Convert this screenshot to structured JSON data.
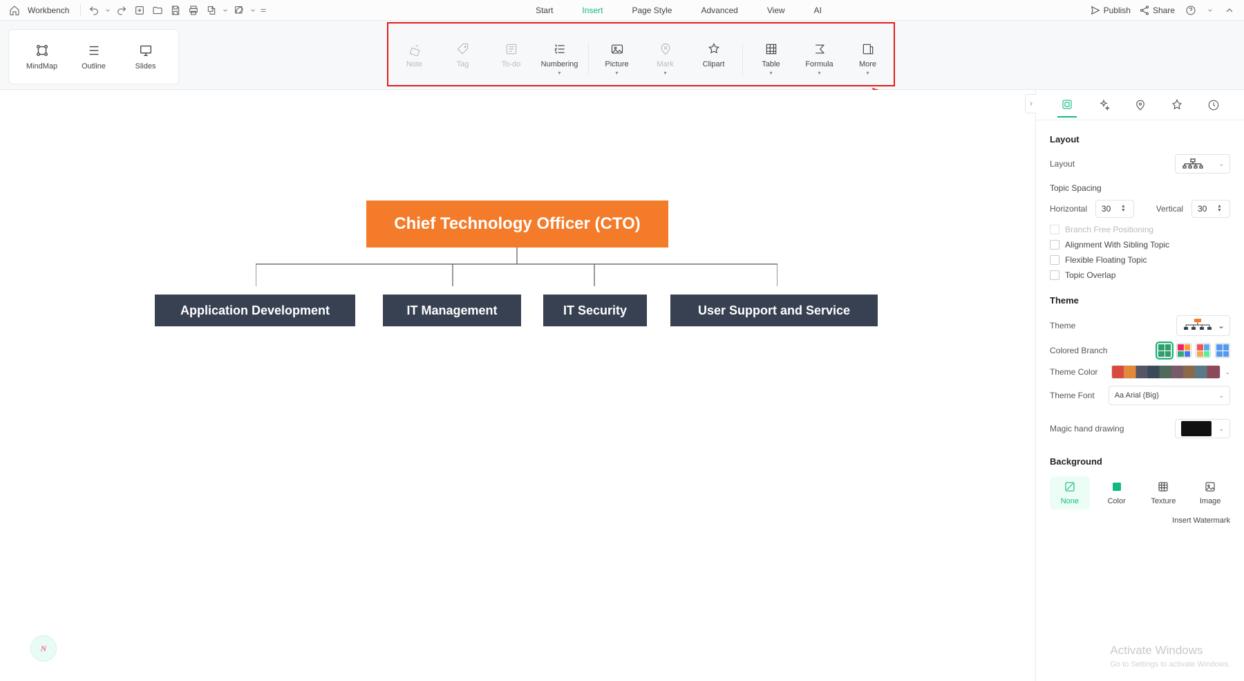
{
  "topbar": {
    "workbench": "Workbench",
    "menus": [
      {
        "label": "Start",
        "active": false
      },
      {
        "label": "Insert",
        "active": true
      },
      {
        "label": "Page Style",
        "active": false
      },
      {
        "label": "Advanced",
        "active": false
      },
      {
        "label": "View",
        "active": false
      },
      {
        "label": "AI",
        "active": false
      }
    ],
    "publish": "Publish",
    "share": "Share"
  },
  "view_modes": [
    {
      "label": "MindMap"
    },
    {
      "label": "Outline"
    },
    {
      "label": "Slides"
    }
  ],
  "insert_ribbon": [
    {
      "label": "Note",
      "disabled": true,
      "dropdown": false
    },
    {
      "label": "Tag",
      "disabled": true,
      "dropdown": false
    },
    {
      "label": "To-do",
      "disabled": true,
      "dropdown": false
    },
    {
      "label": "Numbering",
      "disabled": false,
      "dropdown": true
    },
    {
      "sep": true
    },
    {
      "label": "Picture",
      "disabled": false,
      "dropdown": true
    },
    {
      "label": "Mark",
      "disabled": true,
      "dropdown": true
    },
    {
      "label": "Clipart",
      "disabled": false,
      "dropdown": false
    },
    {
      "sep": true
    },
    {
      "label": "Table",
      "disabled": false,
      "dropdown": true
    },
    {
      "label": "Formula",
      "disabled": false,
      "dropdown": true
    },
    {
      "label": "More",
      "disabled": false,
      "dropdown": true
    }
  ],
  "mindmap": {
    "root": "Chief Technology Officer (CTO)",
    "children": [
      "Application Development",
      "IT Management",
      "IT Security",
      "User Support and Service"
    ]
  },
  "panel": {
    "layout": {
      "title": "Layout",
      "layout_label": "Layout",
      "spacing_title": "Topic Spacing",
      "horizontal_label": "Horizontal",
      "horizontal_value": "30",
      "vertical_label": "Vertical",
      "vertical_value": "30",
      "checks": {
        "branch_free": "Branch Free Positioning",
        "alignment_sibling": "Alignment With Sibling Topic",
        "flexible_floating": "Flexible Floating Topic",
        "topic_overlap": "Topic Overlap"
      }
    },
    "theme": {
      "title": "Theme",
      "theme_label": "Theme",
      "colored_branch": "Colored Branch",
      "theme_color": "Theme Color",
      "theme_font": "Theme Font",
      "theme_font_value": "Arial (Big)",
      "magic_hand": "Magic hand drawing"
    },
    "background": {
      "title": "Background",
      "options": [
        "None",
        "Color",
        "Texture",
        "Image"
      ],
      "watermark": "Insert Watermark"
    }
  },
  "ghost": {
    "line1": "Activate Windows",
    "line2": "Go to Settings to activate Windows."
  }
}
